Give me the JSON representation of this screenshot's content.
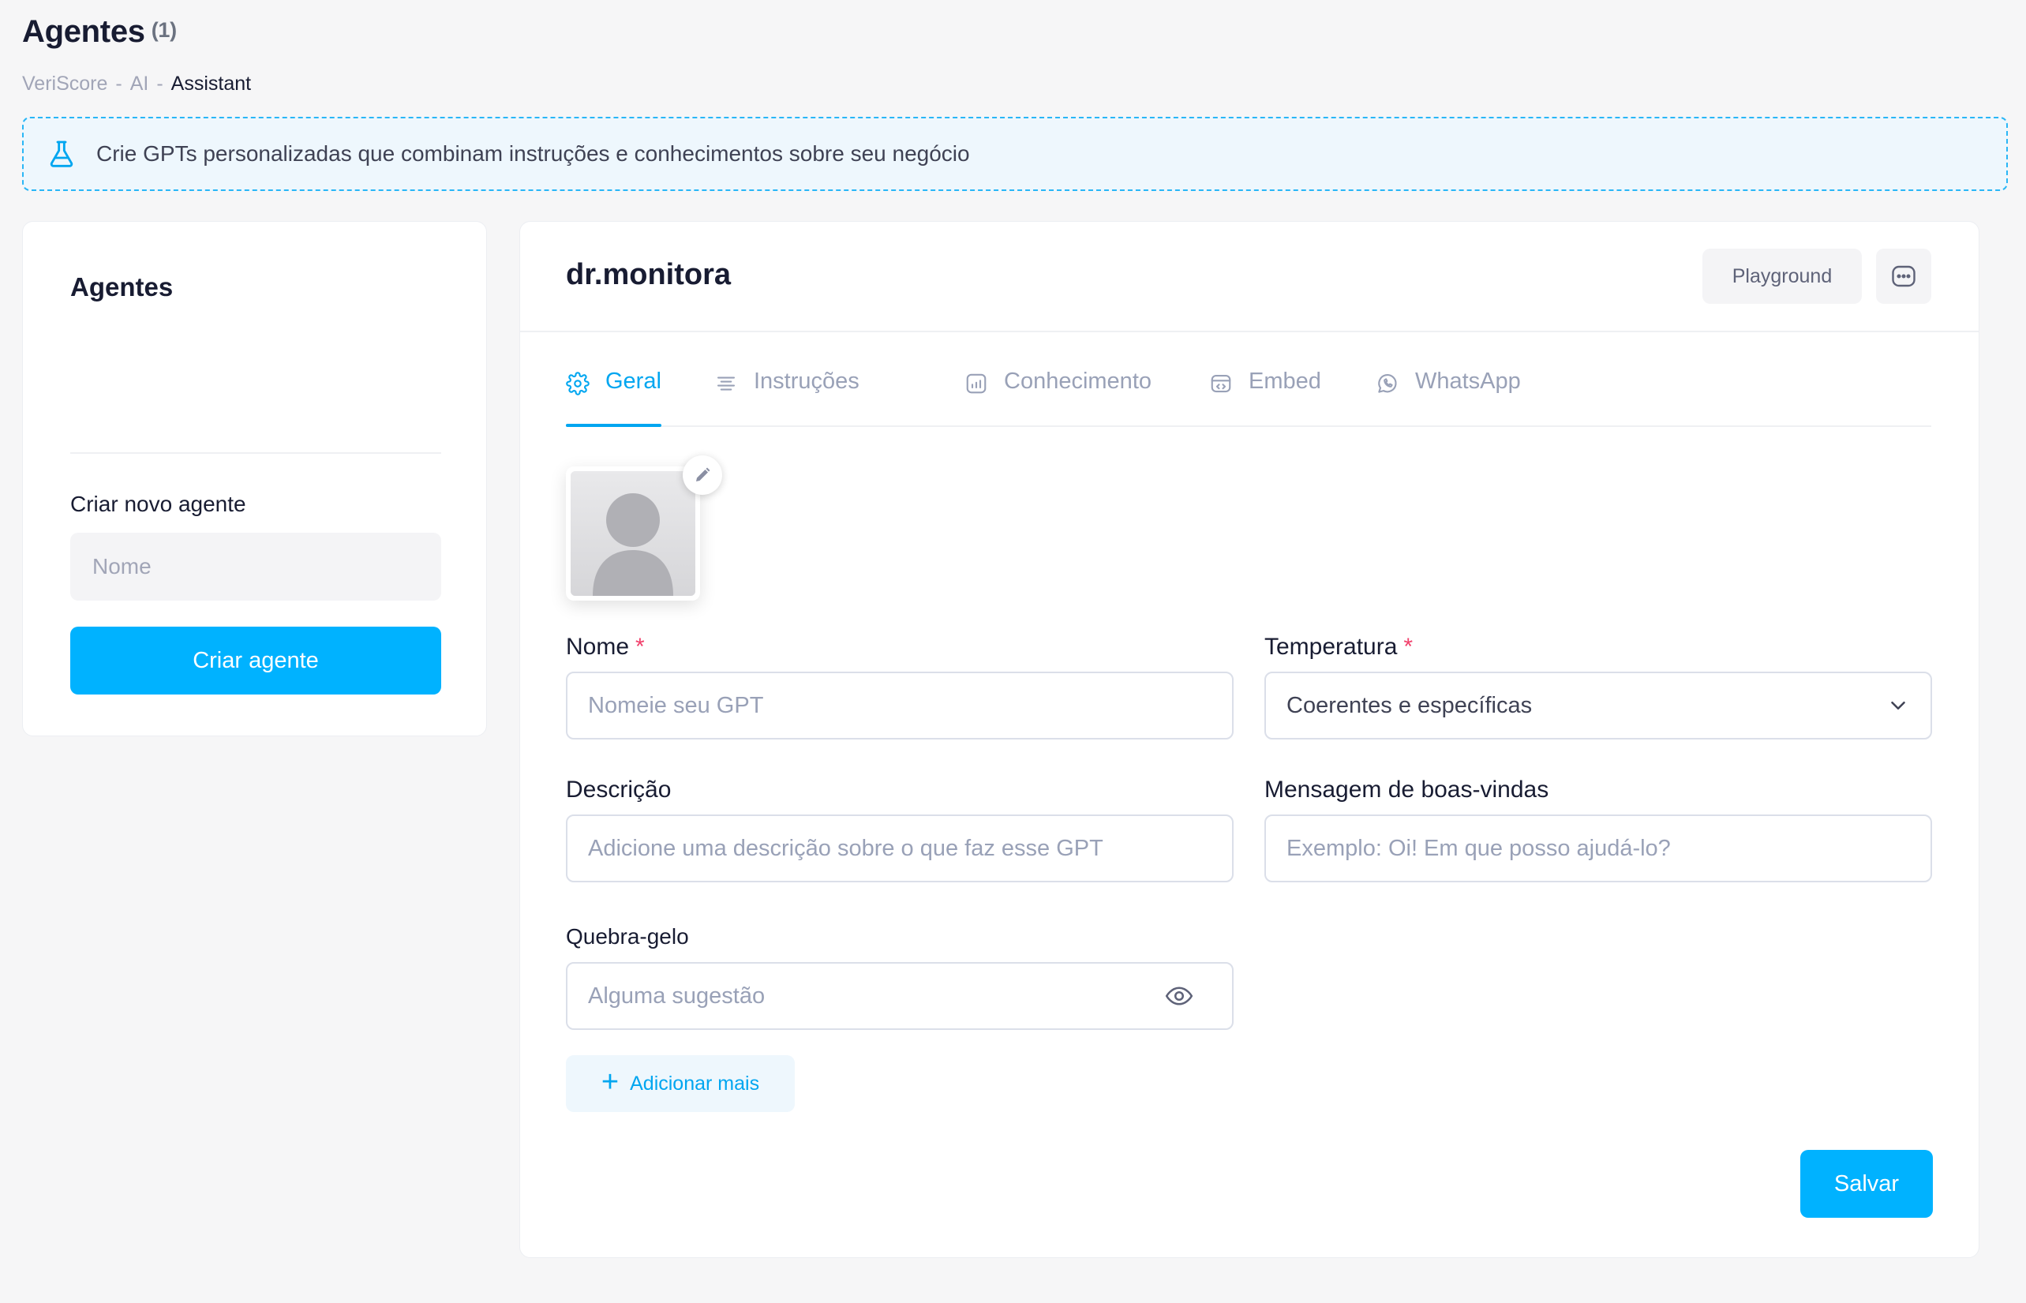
{
  "header": {
    "title": "Agentes",
    "count": "(1)",
    "breadcrumb": [
      "VeriScore",
      "AI",
      "Assistant"
    ],
    "breadcrumb_sep": "-"
  },
  "notice": {
    "icon": "flask-icon",
    "text": "Crie GPTs personalizadas que combinam instruções e conhecimentos sobre seu negócio"
  },
  "sidebar": {
    "title": "Agentes",
    "create_label": "Criar novo agente",
    "name_placeholder": "Nome",
    "create_button": "Criar agente"
  },
  "agent": {
    "name": "dr.monitora",
    "playground_button": "Playground",
    "more_icon": "more-horizontal-icon"
  },
  "tabs": [
    {
      "label": "Geral",
      "icon": "gear-icon",
      "active": true
    },
    {
      "label": "Instruções",
      "icon": "align-left-icon",
      "active": false
    },
    {
      "label": "Conhecimento",
      "icon": "chart-icon",
      "active": false
    },
    {
      "label": "Embed",
      "icon": "embed-icon",
      "active": false
    },
    {
      "label": "WhatsApp",
      "icon": "whatsapp-icon",
      "active": false
    }
  ],
  "form": {
    "nome_label": "Nome",
    "nome_placeholder": "Nomeie seu GPT",
    "temperatura_label": "Temperatura",
    "temperatura_value": "Coerentes e específicas",
    "descricao_label": "Descrição",
    "descricao_placeholder": "Adicione uma descrição sobre o que faz esse GPT",
    "mensagem_label": "Mensagem de boas-vindas",
    "mensagem_placeholder": "Exemplo: Oi! Em que posso ajudá-lo?",
    "quebra_label": "Quebra-gelo",
    "quebra_placeholder": "Alguma sugestão",
    "required_mark": "*",
    "add_more": "Adicionar mais",
    "add_more_icon": "+",
    "save": "Salvar"
  },
  "colors": {
    "accent": "#00b2ff",
    "accent_text": "#00a6f0",
    "required": "#f1416c",
    "notice_border": "#29b6f6",
    "background": "#f6f6f7"
  }
}
